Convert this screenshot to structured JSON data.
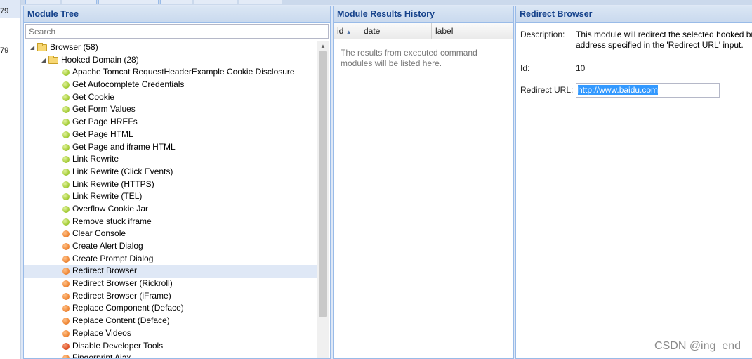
{
  "left_strip": {
    "rows": [
      "79",
      "79"
    ]
  },
  "tree_panel": {
    "title": "Module Tree",
    "search_placeholder": "Search",
    "nodes": [
      {
        "label": "Browser (58)",
        "level": 0,
        "type": "folder"
      },
      {
        "label": "Hooked Domain (28)",
        "level": 1,
        "type": "folder"
      },
      {
        "label": "Apache Tomcat RequestHeaderExample Cookie Disclosure",
        "level": 2,
        "status": "green"
      },
      {
        "label": "Get Autocomplete Credentials",
        "level": 2,
        "status": "green"
      },
      {
        "label": "Get Cookie",
        "level": 2,
        "status": "green"
      },
      {
        "label": "Get Form Values",
        "level": 2,
        "status": "green"
      },
      {
        "label": "Get Page HREFs",
        "level": 2,
        "status": "green"
      },
      {
        "label": "Get Page HTML",
        "level": 2,
        "status": "green"
      },
      {
        "label": "Get Page and iframe HTML",
        "level": 2,
        "status": "green"
      },
      {
        "label": "Link Rewrite",
        "level": 2,
        "status": "green"
      },
      {
        "label": "Link Rewrite (Click Events)",
        "level": 2,
        "status": "green"
      },
      {
        "label": "Link Rewrite (HTTPS)",
        "level": 2,
        "status": "green"
      },
      {
        "label": "Link Rewrite (TEL)",
        "level": 2,
        "status": "green"
      },
      {
        "label": "Overflow Cookie Jar",
        "level": 2,
        "status": "green"
      },
      {
        "label": "Remove stuck iframe",
        "level": 2,
        "status": "green"
      },
      {
        "label": "Clear Console",
        "level": 2,
        "status": "orange"
      },
      {
        "label": "Create Alert Dialog",
        "level": 2,
        "status": "orange"
      },
      {
        "label": "Create Prompt Dialog",
        "level": 2,
        "status": "orange"
      },
      {
        "label": "Redirect Browser",
        "level": 2,
        "status": "orange",
        "selected": true
      },
      {
        "label": "Redirect Browser (Rickroll)",
        "level": 2,
        "status": "orange"
      },
      {
        "label": "Redirect Browser (iFrame)",
        "level": 2,
        "status": "orange"
      },
      {
        "label": "Replace Component (Deface)",
        "level": 2,
        "status": "orange"
      },
      {
        "label": "Replace Content (Deface)",
        "level": 2,
        "status": "orange"
      },
      {
        "label": "Replace Videos",
        "level": 2,
        "status": "orange"
      },
      {
        "label": "Disable Developer Tools",
        "level": 2,
        "status": "red"
      },
      {
        "label": "Fingerprint Ajax",
        "level": 2,
        "status": "orange"
      }
    ]
  },
  "results_panel": {
    "title": "Module Results History",
    "columns": [
      "id",
      "date",
      "label"
    ],
    "sort_indicator": "▲",
    "empty_text": "The results from executed command modules will be listed here."
  },
  "browser_panel": {
    "title": "Redirect Browser",
    "description_label": "Description:",
    "description_line1": "This module will redirect the selected hooked bro",
    "description_line2": "address specified in the 'Redirect URL' input.",
    "id_label": "Id:",
    "id_value": "10",
    "url_label": "Redirect URL:",
    "url_value": "http://www.baidu.com"
  },
  "watermark": "CSDN @ing_end",
  "colors": {
    "header_text": "#15428b",
    "selected_row": "#dfe8f6",
    "status_green": "#a8cf3c",
    "status_orange": "#f08a3a",
    "status_red": "#e0552a",
    "text_selection": "#3399ff"
  }
}
